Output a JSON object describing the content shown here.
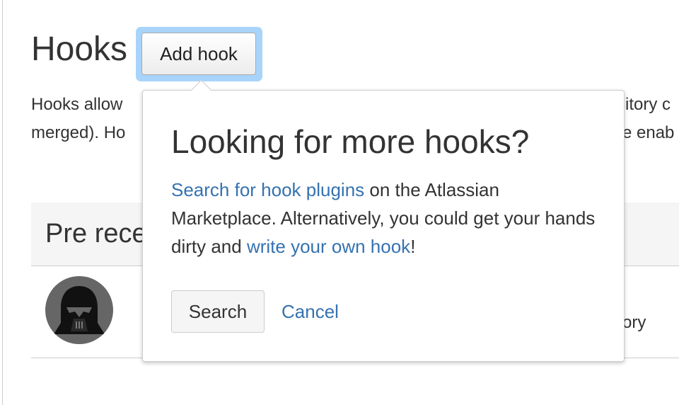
{
  "page": {
    "title": "Hooks",
    "add_hook_label": "Add hook",
    "description_line1": "Hooks allow",
    "description_line1_tail": "sitory c",
    "description_line2": "merged). Ho",
    "description_line2_tail": "e enab"
  },
  "section": {
    "title": "Pre rece",
    "row_tail": "ory"
  },
  "popup": {
    "title": "Looking for more hooks?",
    "link1": "Search for hook plugins",
    "text1": " on the Atlassian Marketplace. Alternatively, you could get your hands dirty and ",
    "link2": "write your own hook",
    "text2": "!",
    "search_label": "Search",
    "cancel_label": "Cancel"
  },
  "icons": {
    "avatar": "darth-vader-avatar-icon"
  },
  "colors": {
    "link": "#3572b0",
    "focus_ring": "#a8d4fb",
    "text": "#333333"
  }
}
